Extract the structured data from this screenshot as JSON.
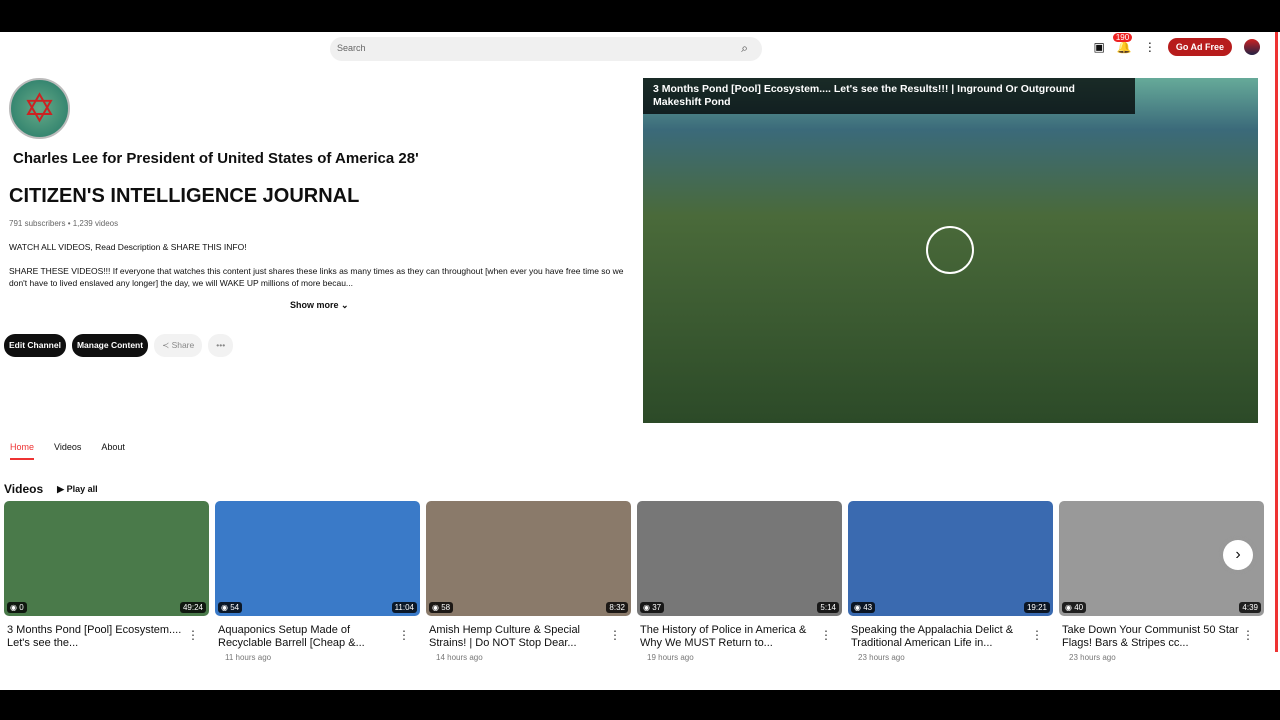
{
  "header": {
    "search_placeholder": "Search",
    "notifications": "190",
    "go_ad_free": "Go Ad Free"
  },
  "channel": {
    "subtitle": "Charles Lee for President of United States of America 28'",
    "name": "CITIZEN'S INTELLIGENCE JOURNAL",
    "stats": "791 subscribers • 1,239 videos",
    "desc1": "WATCH ALL VIDEOS, Read Description & SHARE THIS INFO!",
    "desc2": "SHARE THESE VIDEOS!!! If everyone that watches this content just shares these links as many times as they can throughout [when ever you have free time so we don't have to lived enslaved any longer] the day, we will WAKE UP millions of more becau...",
    "show_more": "Show more ⌄",
    "edit": "Edit Channel",
    "manage": "Manage Content",
    "share": "Share"
  },
  "featured": {
    "title": "3 Months Pond [Pool] Ecosystem.... Let's see the Results!!! | Inground Or Outground Makeshift Pond"
  },
  "tabs": [
    "Home",
    "Videos",
    "About"
  ],
  "videos_section": {
    "title": "Videos",
    "play_all": "Play all"
  },
  "videos": [
    {
      "title": "3 Months Pond [Pool] Ecosystem.... Let's see the...",
      "views": "0",
      "duration": "49:24",
      "age": "",
      "color": "#4a7a4a"
    },
    {
      "title": "Aquaponics Setup Made of Recyclable Barrell [Cheap &...",
      "views": "54",
      "duration": "11:04",
      "age": "11 hours ago",
      "color": "#3a7ac8"
    },
    {
      "title": "Amish Hemp Culture & Special Strains! | Do NOT Stop Dear...",
      "views": "58",
      "duration": "8:32",
      "age": "14 hours ago",
      "color": "#8a7a6a"
    },
    {
      "title": "The History of Police in America & Why We MUST Return to...",
      "views": "37",
      "duration": "5:14",
      "age": "19 hours ago",
      "color": "#777"
    },
    {
      "title": "Speaking the Appalachia Delict & Traditional American Life in...",
      "views": "43",
      "duration": "19:21",
      "age": "23 hours ago",
      "color": "#3a6ab0"
    },
    {
      "title": "Take Down Your Communist 50 Star Flags! Bars & Stripes cc...",
      "views": "40",
      "duration": "4:39",
      "age": "23 hours ago",
      "color": "#999"
    }
  ]
}
